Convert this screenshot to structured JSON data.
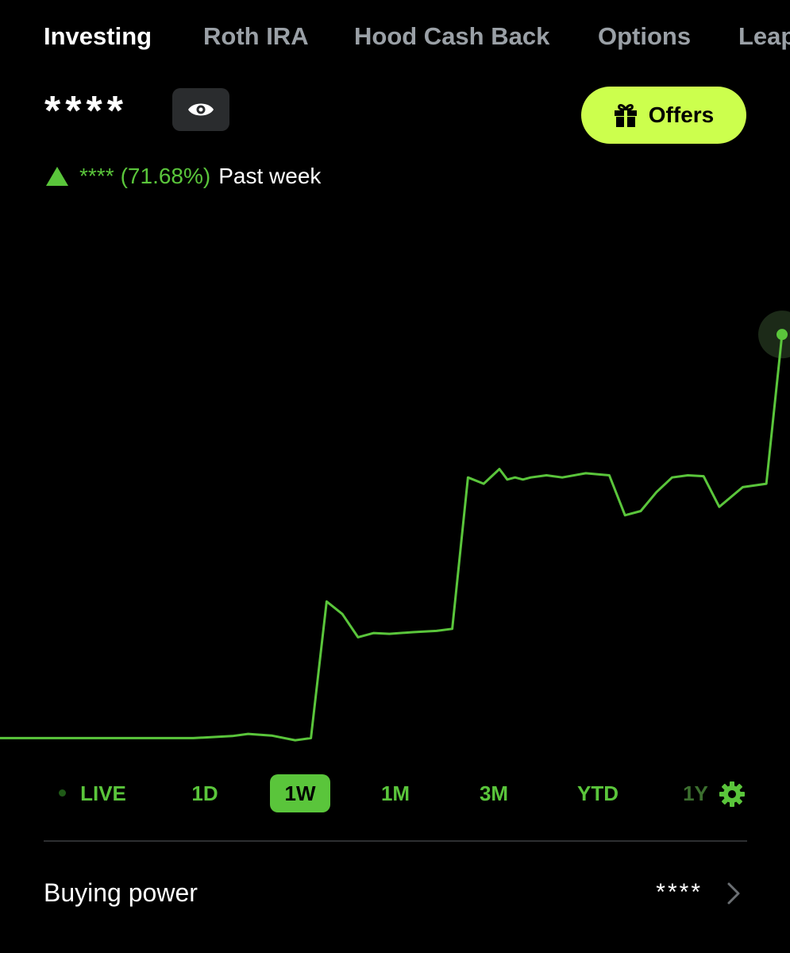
{
  "tabs": [
    {
      "label": "Investing",
      "active": true
    },
    {
      "label": "Roth IRA",
      "active": false
    },
    {
      "label": "Hood Cash Back",
      "active": false
    },
    {
      "label": "Options",
      "active": false
    },
    {
      "label": "Leap",
      "active": false
    }
  ],
  "portfolio": {
    "balance": "****",
    "visibility_icon": "eye-icon",
    "change_icon": "triangle-up-icon",
    "change_value": "****",
    "change_percent": "(71.68%)",
    "change_period": "Past week"
  },
  "offers": {
    "label": "Offers",
    "icon": "gift-icon"
  },
  "colors": {
    "accent_green": "#5ac53b",
    "offers_yellow": "#ccff4d",
    "background": "#000000",
    "muted_tab": "#9aa0a6"
  },
  "chart_data": {
    "type": "line",
    "title": "",
    "xlabel": "",
    "ylabel": "",
    "note": "values are relative (balance hidden); y normalized 0 = lowest, 100 = highest",
    "x": [
      0,
      5,
      10,
      15,
      20,
      25,
      30,
      32,
      35,
      38,
      40,
      42,
      44,
      46,
      48,
      50,
      53,
      56,
      58,
      60,
      62,
      64,
      65,
      66,
      67,
      68,
      70,
      72,
      75,
      78,
      80,
      82,
      84,
      86,
      88,
      90,
      92,
      95,
      98,
      100
    ],
    "y": [
      0,
      0,
      0,
      0,
      0,
      0,
      0.5,
      1,
      0.6,
      -0.5,
      0,
      32.5,
      29.5,
      24,
      25,
      24.8,
      25.2,
      25.5,
      26,
      62,
      60.5,
      64,
      61.5,
      62,
      61.5,
      62,
      62.5,
      62,
      63,
      62.5,
      53,
      54,
      58.5,
      62,
      62.5,
      62.3,
      55,
      59.7,
      60.5,
      96
    ]
  },
  "time_ranges": [
    {
      "label": "LIVE",
      "selected": false
    },
    {
      "label": "1D",
      "selected": false
    },
    {
      "label": "1W",
      "selected": true
    },
    {
      "label": "1M",
      "selected": false
    },
    {
      "label": "3M",
      "selected": false
    },
    {
      "label": "YTD",
      "selected": false
    },
    {
      "label": "1Y",
      "selected": false
    }
  ],
  "chart_settings_icon": "gear-icon",
  "buying_power": {
    "label": "Buying power",
    "value": "****",
    "icon": "chevron-right-icon"
  }
}
